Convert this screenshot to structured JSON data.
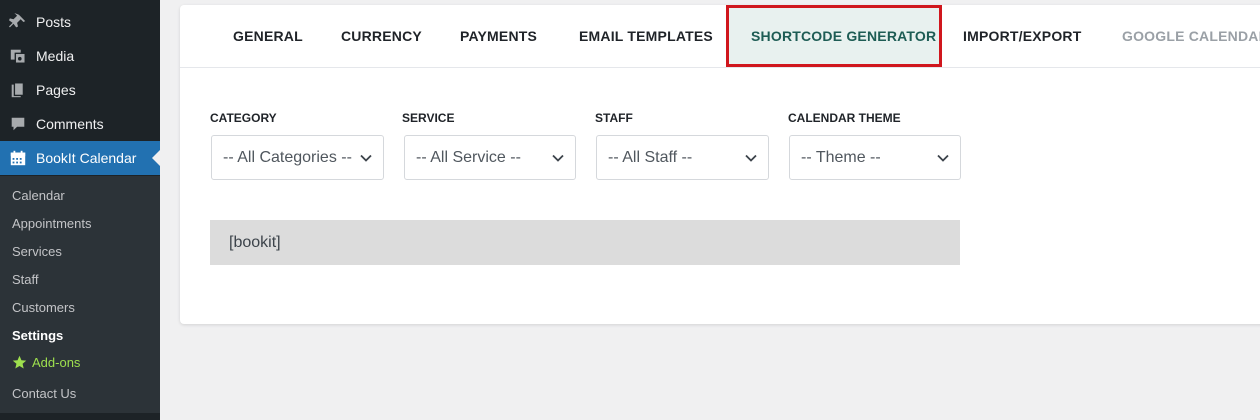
{
  "sidebar": {
    "menu": [
      {
        "label": "Posts",
        "icon": "pin-icon"
      },
      {
        "label": "Media",
        "icon": "media-icon"
      },
      {
        "label": "Pages",
        "icon": "pages-icon"
      },
      {
        "label": "Comments",
        "icon": "comment-icon"
      },
      {
        "label": "BookIt Calendar",
        "icon": "calendar-icon"
      }
    ],
    "submenu": [
      {
        "label": "Calendar"
      },
      {
        "label": "Appointments"
      },
      {
        "label": "Services"
      },
      {
        "label": "Staff"
      },
      {
        "label": "Customers"
      },
      {
        "label": "Settings"
      },
      {
        "label": "Add-ons",
        "icon": "star-icon"
      },
      {
        "label": "Contact Us"
      }
    ],
    "colors": {
      "background": "#1d2327",
      "active": "#2271b1",
      "addons": "#9ee04e"
    }
  },
  "tabs": [
    {
      "label": "GENERAL"
    },
    {
      "label": "CURRENCY"
    },
    {
      "label": "PAYMENTS"
    },
    {
      "label": "EMAIL TEMPLATES"
    },
    {
      "label": "SHORTCODE GENERATOR",
      "active": true
    },
    {
      "label": "IMPORT/EXPORT"
    },
    {
      "label": "GOOGLE CALENDAR",
      "muted": true
    }
  ],
  "filters": [
    {
      "label": "CATEGORY",
      "value": "-- All Categories --"
    },
    {
      "label": "SERVICE",
      "value": "-- All Service --"
    },
    {
      "label": "STAFF",
      "value": "-- All Staff --"
    },
    {
      "label": "CALENDAR THEME",
      "value": "-- Theme --"
    }
  ],
  "shortcode": {
    "value": "[bookit]"
  },
  "colors": {
    "highlight_border": "#d0161d",
    "active_tab_bg": "#e8f1ef",
    "active_tab_text": "#1d5c54"
  }
}
